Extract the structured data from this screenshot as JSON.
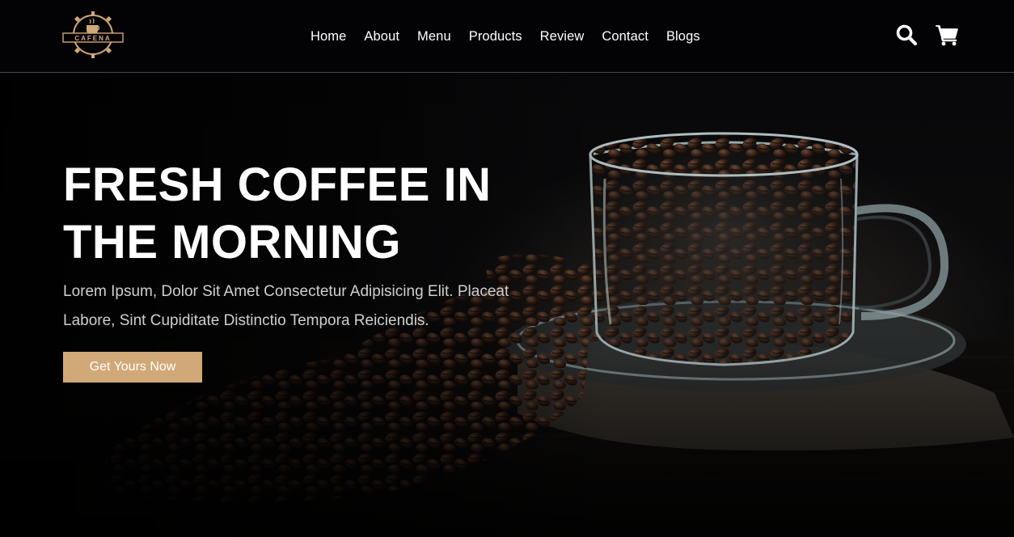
{
  "brand": {
    "logo_text": "CAFENA",
    "accent_color": "#d1a877"
  },
  "nav": {
    "items": [
      {
        "label": "Home"
      },
      {
        "label": "About"
      },
      {
        "label": "Menu"
      },
      {
        "label": "Products"
      },
      {
        "label": "Review"
      },
      {
        "label": "Contact"
      },
      {
        "label": "Blogs"
      }
    ]
  },
  "header_icons": {
    "search": "search-icon",
    "cart": "cart-icon"
  },
  "hero": {
    "title_line1": "FRESH COFFEE IN",
    "title_line2": "THE MORNING",
    "subtitle_line1": "Lorem Ipsum, Dolor Sit Amet Consectetur Adipisicing Elit. Placeat",
    "subtitle_line2": "Labore, Sint Cupiditate Distinctio Tempora Reiciendis.",
    "cta_label": "Get Yours Now",
    "image": "coffee-beans-glass-cup"
  }
}
